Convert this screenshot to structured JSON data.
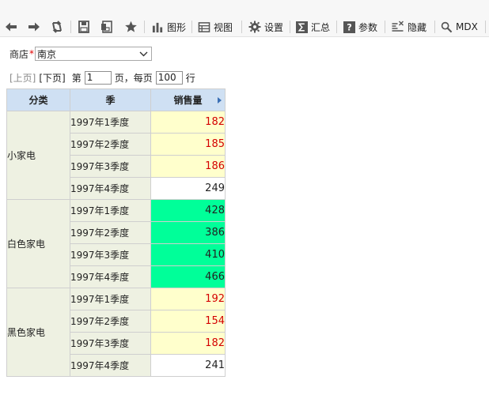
{
  "toolbar": {
    "chart_label": "图形",
    "view_label": "视图",
    "settings_label": "设置",
    "summary_label": "汇总",
    "params_label": "参数",
    "hide_label": "隐藏",
    "mdx_label": "MDX"
  },
  "filter": {
    "store_label": "商店",
    "required_mark": "*",
    "store_value": "南京"
  },
  "pager": {
    "prev_label": "[上页]",
    "next_label": "[下页]",
    "page_prefix": "第",
    "page_value": "1",
    "page_suffix": "页，每页",
    "per_page_value": "100",
    "rows_suffix": "行"
  },
  "table": {
    "headers": {
      "category": "分类",
      "season": "季",
      "sales": "销售量"
    },
    "groups": [
      {
        "category": "小家电",
        "rows": [
          {
            "season": "1997年1季度",
            "value": "182",
            "style": "yellow"
          },
          {
            "season": "1997年2季度",
            "value": "185",
            "style": "yellow"
          },
          {
            "season": "1997年3季度",
            "value": "186",
            "style": "yellow"
          },
          {
            "season": "1997年4季度",
            "value": "249",
            "style": "white"
          }
        ]
      },
      {
        "category": "白色家电",
        "rows": [
          {
            "season": "1997年1季度",
            "value": "428",
            "style": "green"
          },
          {
            "season": "1997年2季度",
            "value": "386",
            "style": "green"
          },
          {
            "season": "1997年3季度",
            "value": "410",
            "style": "green"
          },
          {
            "season": "1997年4季度",
            "value": "466",
            "style": "green"
          }
        ]
      },
      {
        "category": "黑色家电",
        "rows": [
          {
            "season": "1997年1季度",
            "value": "192",
            "style": "yellow"
          },
          {
            "season": "1997年2季度",
            "value": "154",
            "style": "yellow"
          },
          {
            "season": "1997年3季度",
            "value": "182",
            "style": "yellow"
          },
          {
            "season": "1997年4季度",
            "value": "241",
            "style": "white"
          }
        ]
      }
    ]
  },
  "colors": {
    "header_bg": "#cfe0f3",
    "dimension_bg": "#eef1e2",
    "warning_bg": "#ffffcc",
    "warning_text": "#d40000",
    "highlight_bg": "#00ff99"
  }
}
